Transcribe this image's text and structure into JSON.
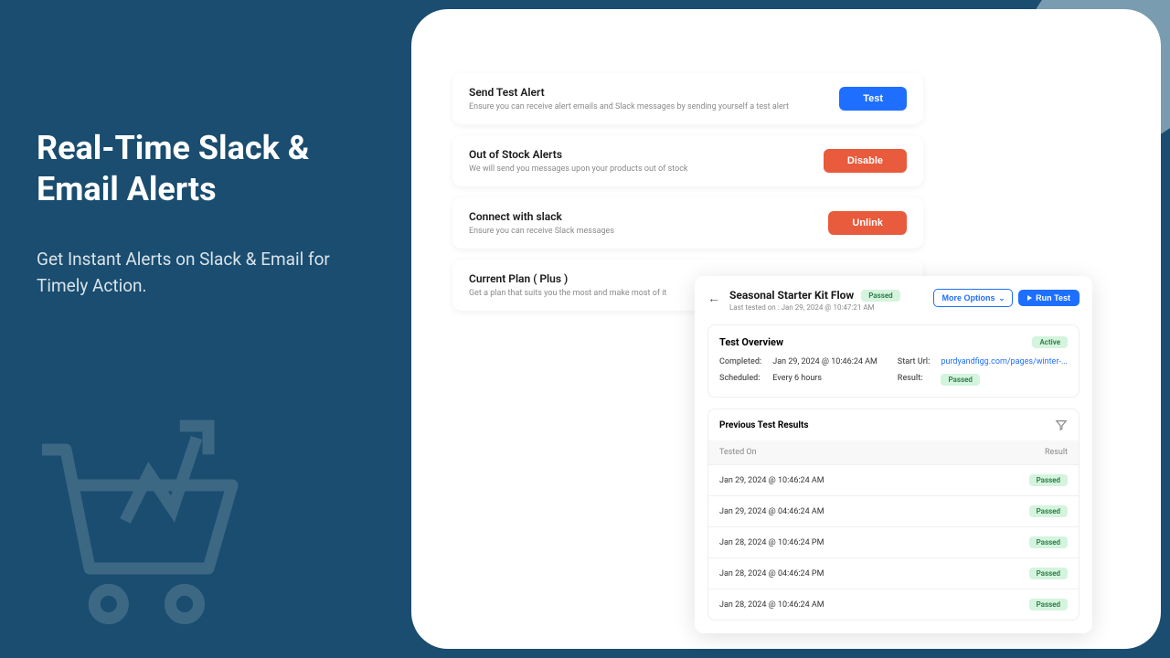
{
  "hero": {
    "title": "Real-Time Slack & Email Alerts",
    "subtitle": "Get Instant Alerts on Slack & Email for Timely Action."
  },
  "settings": [
    {
      "title": "Send Test Alert",
      "desc": "Ensure you can receive alert emails and Slack messages by sending yourself a test alert",
      "button": "Test",
      "style": "blue"
    },
    {
      "title": "Out of Stock Alerts",
      "desc": "We will send you messages upon your products out of stock",
      "button": "Disable",
      "style": "orange"
    },
    {
      "title": "Connect with slack",
      "desc": "Ensure you can receive Slack messages",
      "button": "Unlink",
      "style": "orange"
    },
    {
      "title": "Current Plan ( Plus )",
      "desc": "Get a plan that suits you the most and make most of it",
      "button": "",
      "style": ""
    }
  ],
  "flow": {
    "title": "Seasonal Starter Kit Flow",
    "title_badge": "Passed",
    "last_tested": "Last tested on : Jan 29, 2024 @ 10:47:21 AM",
    "more_options": "More Options",
    "run_test": "Run Test",
    "overview": {
      "title": "Test Overview",
      "status": "Active",
      "completed_label": "Completed:",
      "completed_value": "Jan 29, 2024 @ 10:46:24 AM",
      "start_url_label": "Start Url:",
      "start_url_value": "purdyandfigg.com/pages/winter-...",
      "scheduled_label": "Scheduled:",
      "scheduled_value": "Every 6 hours",
      "result_label": "Result:",
      "result_value": "Passed"
    },
    "results": {
      "title": "Previous Test Results",
      "col_tested": "Tested On",
      "col_result": "Result",
      "rows": [
        {
          "date": "Jan 29, 2024 @ 10:46:24 AM",
          "result": "Passed"
        },
        {
          "date": "Jan 29, 2024 @ 04:46:24 AM",
          "result": "Passed"
        },
        {
          "date": "Jan 28, 2024 @ 10:46:24 PM",
          "result": "Passed"
        },
        {
          "date": "Jan 28, 2024 @ 04:46:24 PM",
          "result": "Passed"
        },
        {
          "date": "Jan 28, 2024 @ 10:46:24 AM",
          "result": "Passed"
        }
      ]
    }
  }
}
